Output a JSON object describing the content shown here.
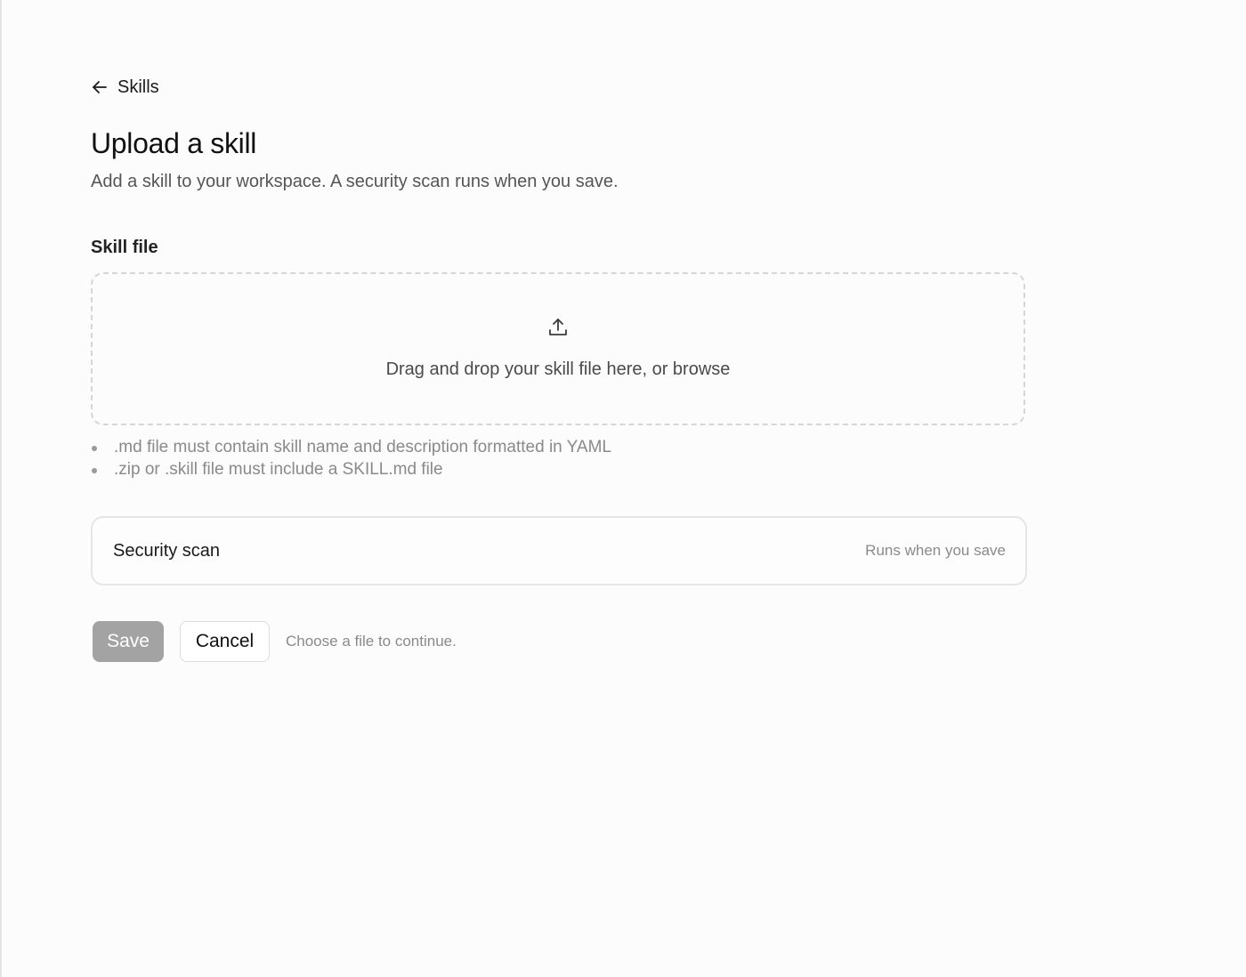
{
  "nav": {
    "back_label": "Skills",
    "back_icon": "arrow-left-icon"
  },
  "header": {
    "title": "Upload a skill",
    "subtitle": "Add a skill to your workspace. A security scan runs when you save."
  },
  "skill_file": {
    "label": "Skill file",
    "dropzone_icon": "upload-icon",
    "dropzone_text": "Drag and drop your skill file here, or browse",
    "hints": [
      ".md file must contain skill name and description formatted in YAML",
      ".zip or .skill file must include a SKILL.md file"
    ]
  },
  "security_scan": {
    "title": "Security scan",
    "status": "Runs when you save"
  },
  "actions": {
    "save_label": "Save",
    "save_disabled": true,
    "cancel_label": "Cancel",
    "hint": "Choose a file to continue."
  },
  "colors": {
    "background": "#fcfcfc",
    "save_disabled": "#a3a3a3",
    "muted_text": "#8a8a8a",
    "border": "#e6e6e6"
  }
}
